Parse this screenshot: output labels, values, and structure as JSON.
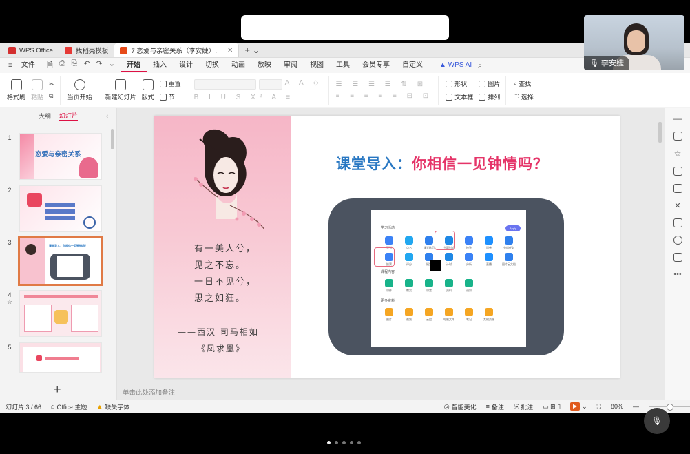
{
  "meeting": {
    "presenter_name": "李安婕"
  },
  "tabs": [
    {
      "label": "WPS Office",
      "color": "#d32f2f"
    },
    {
      "label": "找稻壳模板",
      "color": "#e53935"
    },
    {
      "label": "7 恋爱与亲密关系（李安婕）.",
      "color": "#e64a19"
    }
  ],
  "menu": {
    "file": "文件",
    "items": [
      "开始",
      "插入",
      "设计",
      "切换",
      "动画",
      "放映",
      "审阅",
      "视图",
      "工具",
      "会员专享",
      "自定义"
    ],
    "active": "开始",
    "wps_ai": "WPS AI"
  },
  "ribbon": {
    "format_painter": "格式刷",
    "paste": "粘贴",
    "from_current": "当页开始",
    "new_slide": "新建幻灯片",
    "layout": "版式",
    "reset": "重置",
    "section": "节",
    "shape": "形状",
    "picture": "图片",
    "textbox": "文本框",
    "arrange": "排列",
    "find": "查找",
    "select": "选择"
  },
  "panel": {
    "outline_tab": "大纲",
    "slides_tab": "幻灯片"
  },
  "thumbnails": [
    {
      "num": "1",
      "title": "恋爱与亲密关系"
    },
    {
      "num": "2",
      "title": ""
    },
    {
      "num": "3",
      "title": "课堂导入：你相信一见钟情吗？"
    },
    {
      "num": "4",
      "title": ""
    },
    {
      "num": "5",
      "title": ""
    }
  ],
  "slide": {
    "title_blue": "课堂导入：",
    "title_red": "你相信一见钟情吗？",
    "poem": [
      "有一美人兮，",
      "见之不忘。",
      "一日不见兮，",
      "思之如狂。"
    ],
    "author": "——西汉 司马相如",
    "work": "《凤求凰》",
    "screen": {
      "section1": "学习活动",
      "section2": "课程内容",
      "section3": "更多资料",
      "apps1": [
        "签到",
        "点名",
        "课堂练习",
        "主题讨论",
        "抢答",
        "问卷",
        "分组任务",
        "投票",
        "评分",
        "随堂",
        "计时",
        "分析",
        "直播",
        "图片云文档"
      ],
      "apps2": [
        "课件",
        "教案",
        "课堂",
        "资料",
        "通知"
      ],
      "apps3": [
        "图片",
        "视频",
        "云盘",
        "电脑文件",
        "笔记",
        "其他资源"
      ],
      "button": "Apply"
    }
  },
  "notes_placeholder": "单击此处添加备注",
  "status": {
    "slide_counter": "幻灯片 3 / 66",
    "theme": "Office 主题",
    "missing_font": "缺失字体",
    "beautify": "智能美化",
    "notes": "备注",
    "comment": "批注",
    "zoom": "80%"
  }
}
